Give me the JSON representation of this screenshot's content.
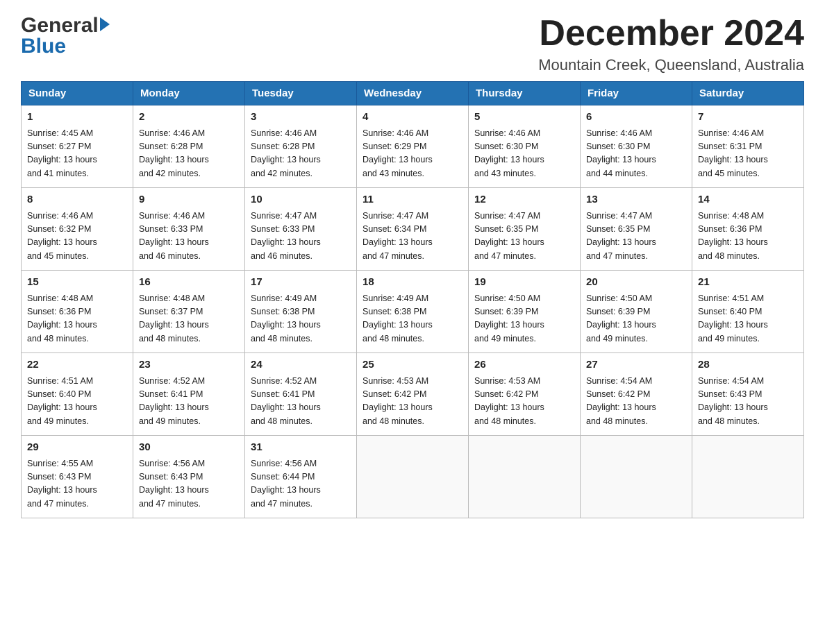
{
  "header": {
    "title": "December 2024",
    "subtitle": "Mountain Creek, Queensland, Australia"
  },
  "logo": {
    "general": "General",
    "blue": "Blue"
  },
  "days_of_week": [
    "Sunday",
    "Monday",
    "Tuesday",
    "Wednesday",
    "Thursday",
    "Friday",
    "Saturday"
  ],
  "weeks": [
    [
      {
        "day": "1",
        "sunrise": "4:45 AM",
        "sunset": "6:27 PM",
        "daylight": "13 hours and 41 minutes."
      },
      {
        "day": "2",
        "sunrise": "4:46 AM",
        "sunset": "6:28 PM",
        "daylight": "13 hours and 42 minutes."
      },
      {
        "day": "3",
        "sunrise": "4:46 AM",
        "sunset": "6:28 PM",
        "daylight": "13 hours and 42 minutes."
      },
      {
        "day": "4",
        "sunrise": "4:46 AM",
        "sunset": "6:29 PM",
        "daylight": "13 hours and 43 minutes."
      },
      {
        "day": "5",
        "sunrise": "4:46 AM",
        "sunset": "6:30 PM",
        "daylight": "13 hours and 43 minutes."
      },
      {
        "day": "6",
        "sunrise": "4:46 AM",
        "sunset": "6:30 PM",
        "daylight": "13 hours and 44 minutes."
      },
      {
        "day": "7",
        "sunrise": "4:46 AM",
        "sunset": "6:31 PM",
        "daylight": "13 hours and 45 minutes."
      }
    ],
    [
      {
        "day": "8",
        "sunrise": "4:46 AM",
        "sunset": "6:32 PM",
        "daylight": "13 hours and 45 minutes."
      },
      {
        "day": "9",
        "sunrise": "4:46 AM",
        "sunset": "6:33 PM",
        "daylight": "13 hours and 46 minutes."
      },
      {
        "day": "10",
        "sunrise": "4:47 AM",
        "sunset": "6:33 PM",
        "daylight": "13 hours and 46 minutes."
      },
      {
        "day": "11",
        "sunrise": "4:47 AM",
        "sunset": "6:34 PM",
        "daylight": "13 hours and 47 minutes."
      },
      {
        "day": "12",
        "sunrise": "4:47 AM",
        "sunset": "6:35 PM",
        "daylight": "13 hours and 47 minutes."
      },
      {
        "day": "13",
        "sunrise": "4:47 AM",
        "sunset": "6:35 PM",
        "daylight": "13 hours and 47 minutes."
      },
      {
        "day": "14",
        "sunrise": "4:48 AM",
        "sunset": "6:36 PM",
        "daylight": "13 hours and 48 minutes."
      }
    ],
    [
      {
        "day": "15",
        "sunrise": "4:48 AM",
        "sunset": "6:36 PM",
        "daylight": "13 hours and 48 minutes."
      },
      {
        "day": "16",
        "sunrise": "4:48 AM",
        "sunset": "6:37 PM",
        "daylight": "13 hours and 48 minutes."
      },
      {
        "day": "17",
        "sunrise": "4:49 AM",
        "sunset": "6:38 PM",
        "daylight": "13 hours and 48 minutes."
      },
      {
        "day": "18",
        "sunrise": "4:49 AM",
        "sunset": "6:38 PM",
        "daylight": "13 hours and 48 minutes."
      },
      {
        "day": "19",
        "sunrise": "4:50 AM",
        "sunset": "6:39 PM",
        "daylight": "13 hours and 49 minutes."
      },
      {
        "day": "20",
        "sunrise": "4:50 AM",
        "sunset": "6:39 PM",
        "daylight": "13 hours and 49 minutes."
      },
      {
        "day": "21",
        "sunrise": "4:51 AM",
        "sunset": "6:40 PM",
        "daylight": "13 hours and 49 minutes."
      }
    ],
    [
      {
        "day": "22",
        "sunrise": "4:51 AM",
        "sunset": "6:40 PM",
        "daylight": "13 hours and 49 minutes."
      },
      {
        "day": "23",
        "sunrise": "4:52 AM",
        "sunset": "6:41 PM",
        "daylight": "13 hours and 49 minutes."
      },
      {
        "day": "24",
        "sunrise": "4:52 AM",
        "sunset": "6:41 PM",
        "daylight": "13 hours and 48 minutes."
      },
      {
        "day": "25",
        "sunrise": "4:53 AM",
        "sunset": "6:42 PM",
        "daylight": "13 hours and 48 minutes."
      },
      {
        "day": "26",
        "sunrise": "4:53 AM",
        "sunset": "6:42 PM",
        "daylight": "13 hours and 48 minutes."
      },
      {
        "day": "27",
        "sunrise": "4:54 AM",
        "sunset": "6:42 PM",
        "daylight": "13 hours and 48 minutes."
      },
      {
        "day": "28",
        "sunrise": "4:54 AM",
        "sunset": "6:43 PM",
        "daylight": "13 hours and 48 minutes."
      }
    ],
    [
      {
        "day": "29",
        "sunrise": "4:55 AM",
        "sunset": "6:43 PM",
        "daylight": "13 hours and 47 minutes."
      },
      {
        "day": "30",
        "sunrise": "4:56 AM",
        "sunset": "6:43 PM",
        "daylight": "13 hours and 47 minutes."
      },
      {
        "day": "31",
        "sunrise": "4:56 AM",
        "sunset": "6:44 PM",
        "daylight": "13 hours and 47 minutes."
      },
      null,
      null,
      null,
      null
    ]
  ],
  "labels": {
    "sunrise": "Sunrise:",
    "sunset": "Sunset:",
    "daylight": "Daylight:"
  }
}
